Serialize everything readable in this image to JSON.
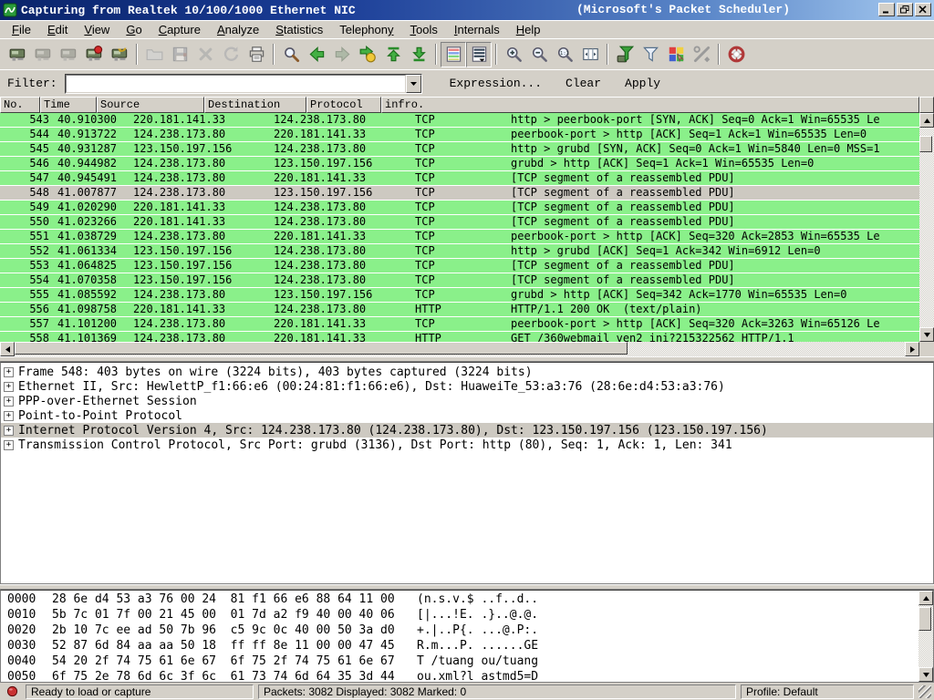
{
  "window": {
    "title": "Capturing from Realtek 10/100/1000 Ethernet NIC",
    "title_note": "(Microsoft's Packet Scheduler)"
  },
  "menu": {
    "items": [
      {
        "label": "File",
        "accel": 0
      },
      {
        "label": "Edit",
        "accel": 0
      },
      {
        "label": "View",
        "accel": 0
      },
      {
        "label": "Go",
        "accel": 0
      },
      {
        "label": "Capture",
        "accel": 0
      },
      {
        "label": "Analyze",
        "accel": 0
      },
      {
        "label": "Statistics",
        "accel": 0
      },
      {
        "label": "Telephony",
        "accel": 8
      },
      {
        "label": "Tools",
        "accel": 0
      },
      {
        "label": "Internals",
        "accel": 0
      },
      {
        "label": "Help",
        "accel": 0
      }
    ]
  },
  "toolbar": {
    "items": [
      {
        "icon": "list-interfaces"
      },
      {
        "icon": "capture-options",
        "state": "disabled"
      },
      {
        "icon": "capture-start",
        "state": "disabled"
      },
      {
        "icon": "capture-stop"
      },
      {
        "icon": "capture-restart"
      },
      {
        "sep": true
      },
      {
        "icon": "open-file",
        "state": "disabled"
      },
      {
        "icon": "save-file",
        "state": "disabled"
      },
      {
        "icon": "close-file",
        "state": "disabled"
      },
      {
        "icon": "reload",
        "state": "disabled"
      },
      {
        "icon": "print"
      },
      {
        "sep": true
      },
      {
        "icon": "find-packet"
      },
      {
        "icon": "go-back"
      },
      {
        "icon": "go-forward",
        "state": "disabled"
      },
      {
        "icon": "go-to-packet"
      },
      {
        "icon": "go-to-top"
      },
      {
        "icon": "go-to-bottom"
      },
      {
        "sep": true
      },
      {
        "icon": "colorize",
        "state": "pressed"
      },
      {
        "icon": "auto-scroll",
        "state": "pressed"
      },
      {
        "sep": true
      },
      {
        "icon": "zoom-in"
      },
      {
        "icon": "zoom-out"
      },
      {
        "icon": "zoom-normal"
      },
      {
        "icon": "resize-columns"
      },
      {
        "sep": true
      },
      {
        "icon": "capture-filter"
      },
      {
        "icon": "display-filter"
      },
      {
        "icon": "coloring-rules"
      },
      {
        "icon": "preferences"
      },
      {
        "sep": true
      },
      {
        "icon": "help"
      }
    ]
  },
  "filter_bar": {
    "label": "Filter:",
    "value": "",
    "expression_label": "Expression...",
    "clear_label": "Clear",
    "apply_label": "Apply"
  },
  "packet_list": {
    "columns": [
      "No.",
      "Time",
      "Source",
      "Destination",
      "Protocol",
      "infro."
    ],
    "rows": [
      {
        "no": "543",
        "time": "40.910300",
        "src": "220.181.141.33",
        "dst": "124.238.173.80",
        "proto": "TCP",
        "info": "http > peerbook-port [SYN, ACK] Seq=0 Ack=1 Win=65535 Le",
        "selected": false
      },
      {
        "no": "544",
        "time": "40.913722",
        "src": "124.238.173.80",
        "dst": "220.181.141.33",
        "proto": "TCP",
        "info": "peerbook-port > http [ACK] Seq=1 Ack=1 Win=65535 Len=0",
        "selected": false
      },
      {
        "no": "545",
        "time": "40.931287",
        "src": "123.150.197.156",
        "dst": "124.238.173.80",
        "proto": "TCP",
        "info": "http > grubd [SYN, ACK] Seq=0 Ack=1 Win=5840 Len=0 MSS=1",
        "selected": false
      },
      {
        "no": "546",
        "time": "40.944982",
        "src": "124.238.173.80",
        "dst": "123.150.197.156",
        "proto": "TCP",
        "info": "grubd > http [ACK] Seq=1 Ack=1 Win=65535 Len=0",
        "selected": false
      },
      {
        "no": "547",
        "time": "40.945491",
        "src": "124.238.173.80",
        "dst": "220.181.141.33",
        "proto": "TCP",
        "info": "[TCP segment of a reassembled PDU]",
        "selected": false
      },
      {
        "no": "548",
        "time": "41.007877",
        "src": "124.238.173.80",
        "dst": "123.150.197.156",
        "proto": "TCP",
        "info": "[TCP segment of a reassembled PDU]",
        "selected": true
      },
      {
        "no": "549",
        "time": "41.020290",
        "src": "220.181.141.33",
        "dst": "124.238.173.80",
        "proto": "TCP",
        "info": "[TCP segment of a reassembled PDU]",
        "selected": false
      },
      {
        "no": "550",
        "time": "41.023266",
        "src": "220.181.141.33",
        "dst": "124.238.173.80",
        "proto": "TCP",
        "info": "[TCP segment of a reassembled PDU]",
        "selected": false
      },
      {
        "no": "551",
        "time": "41.038729",
        "src": "124.238.173.80",
        "dst": "220.181.141.33",
        "proto": "TCP",
        "info": "peerbook-port > http [ACK] Seq=320 Ack=2853 Win=65535 Le",
        "selected": false
      },
      {
        "no": "552",
        "time": "41.061334",
        "src": "123.150.197.156",
        "dst": "124.238.173.80",
        "proto": "TCP",
        "info": "http > grubd [ACK] Seq=1 Ack=342 Win=6912 Len=0",
        "selected": false
      },
      {
        "no": "553",
        "time": "41.064825",
        "src": "123.150.197.156",
        "dst": "124.238.173.80",
        "proto": "TCP",
        "info": "[TCP segment of a reassembled PDU]",
        "selected": false
      },
      {
        "no": "554",
        "time": "41.070358",
        "src": "123.150.197.156",
        "dst": "124.238.173.80",
        "proto": "TCP",
        "info": "[TCP segment of a reassembled PDU]",
        "selected": false
      },
      {
        "no": "555",
        "time": "41.085592",
        "src": "124.238.173.80",
        "dst": "123.150.197.156",
        "proto": "TCP",
        "info": "grubd > http [ACK] Seq=342 Ack=1770 Win=65535 Len=0",
        "selected": false
      },
      {
        "no": "556",
        "time": "41.098758",
        "src": "220.181.141.33",
        "dst": "124.238.173.80",
        "proto": "HTTP",
        "info": "HTTP/1.1 200 OK  (text/plain)",
        "selected": false
      },
      {
        "no": "557",
        "time": "41.101200",
        "src": "124.238.173.80",
        "dst": "220.181.141.33",
        "proto": "TCP",
        "info": "peerbook-port > http [ACK] Seq=320 Ack=3263 Win=65126 Le",
        "selected": false
      },
      {
        "no": "558",
        "time": "41.101369",
        "src": "124.238.173.80",
        "dst": "220.181.141.33",
        "proto": "HTTP",
        "info": "GET /360webmail_ven2_ini?215322562 HTTP/1.1",
        "selected": false
      }
    ]
  },
  "details": {
    "rows": [
      {
        "text": "Frame 548: 403 bytes on wire (3224 bits), 403 bytes captured (3224 bits)",
        "highlight": false
      },
      {
        "text": "Ethernet II, Src: HewlettP_f1:66:e6 (00:24:81:f1:66:e6), Dst: HuaweiTe_53:a3:76 (28:6e:d4:53:a3:76)",
        "highlight": false
      },
      {
        "text": "PPP-over-Ethernet Session",
        "highlight": false
      },
      {
        "text": "Point-to-Point Protocol",
        "highlight": false
      },
      {
        "text": "Internet Protocol Version 4, Src: 124.238.173.80 (124.238.173.80), Dst: 123.150.197.156 (123.150.197.156)",
        "highlight": true
      },
      {
        "text": "Transmission Control Protocol, Src Port: grubd (3136), Dst Port: http (80), Seq: 1, Ack: 1, Len: 341",
        "highlight": false
      }
    ]
  },
  "hex_dump": {
    "rows": [
      {
        "offset": "0000",
        "hex": "28 6e d4 53 a3 76 00 24  81 f1 66 e6 88 64 11 00",
        "ascii": "(n.s.v.$ ..f..d.."
      },
      {
        "offset": "0010",
        "hex": "5b 7c 01 7f 00 21 45 00  01 7d a2 f9 40 00 40 06",
        "ascii": "[|...!E. .}..@.@."
      },
      {
        "offset": "0020",
        "hex": "2b 10 7c ee ad 50 7b 96  c5 9c 0c 40 00 50 3a d0",
        "ascii": "+.|..P{. ...@.P:."
      },
      {
        "offset": "0030",
        "hex": "52 87 6d 84 aa aa 50 18  ff ff 8e 11 00 00 47 45",
        "ascii": "R.m...P. ......GE"
      },
      {
        "offset": "0040",
        "hex": "54 20 2f 74 75 61 6e 67  6f 75 2f 74 75 61 6e 67",
        "ascii": "T /tuang ou/tuang"
      },
      {
        "offset": "0050",
        "hex": "6f 75 2e 78 6d 6c 3f 6c  61 73 74 6d 64 35 3d 44",
        "ascii": "ou.xml?l astmd5=D"
      }
    ]
  },
  "status_bar": {
    "ready": "Ready to load or capture",
    "packets": "Packets: 3082 Displayed: 3082 Marked: 0",
    "profile": "Profile: Default"
  },
  "colors": {
    "row_green": "#8AF08A",
    "selected_gray": "#CDC9C1",
    "titlebar_left": "#0A246A",
    "titlebar_right": "#A6CAF0"
  }
}
